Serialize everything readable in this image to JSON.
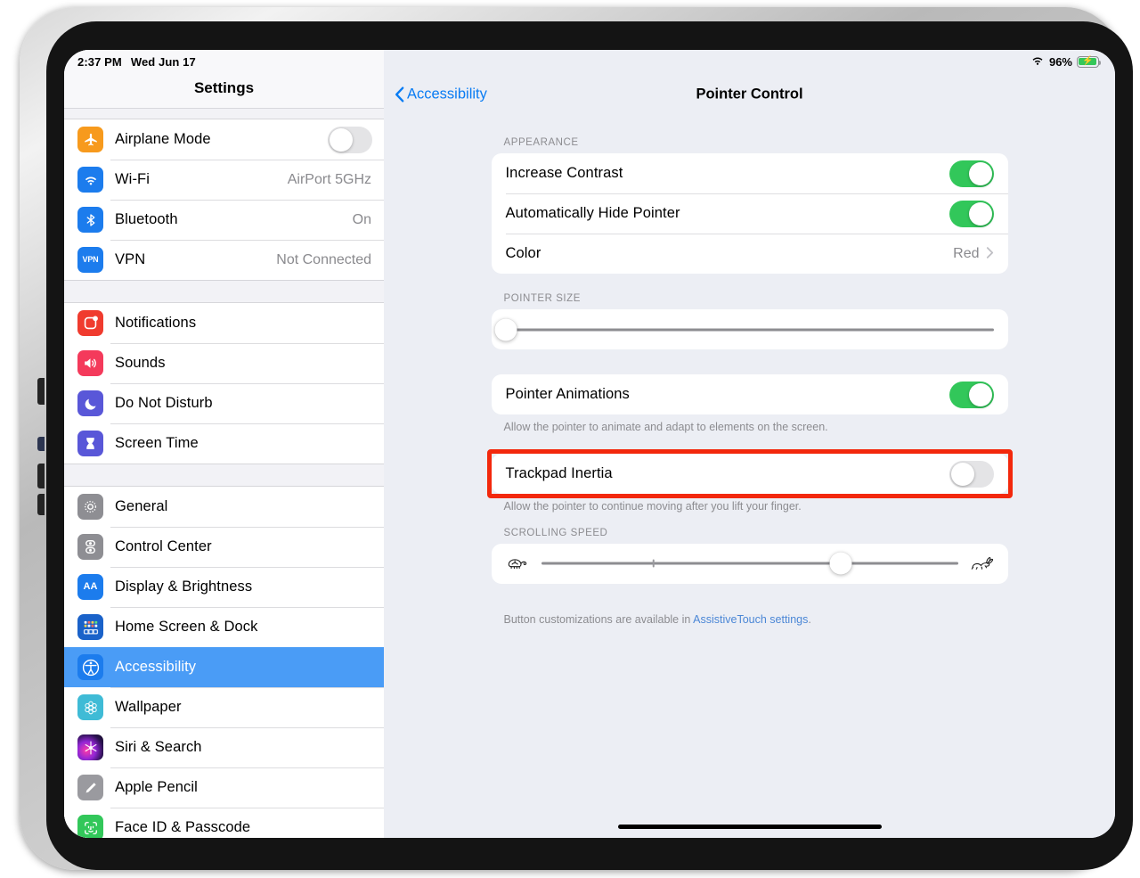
{
  "status_bar": {
    "time": "2:37 PM",
    "date": "Wed Jun 17",
    "battery_percent": "96%",
    "battery_level": 96,
    "wifi_icon": "wifi-icon",
    "battery_icon": "battery-charging-icon"
  },
  "sidebar": {
    "title": "Settings",
    "groups": [
      {
        "items": [
          {
            "label": "Airplane Mode",
            "icon": "airplane-icon",
            "control": "toggle",
            "toggle_on": false
          },
          {
            "label": "Wi-Fi",
            "icon": "wifi-icon",
            "value": "AirPort 5GHz"
          },
          {
            "label": "Bluetooth",
            "icon": "bluetooth-icon",
            "value": "On"
          },
          {
            "label": "VPN",
            "icon": "vpn-icon",
            "value": "Not Connected"
          }
        ]
      },
      {
        "items": [
          {
            "label": "Notifications",
            "icon": "notifications-icon"
          },
          {
            "label": "Sounds",
            "icon": "sounds-icon"
          },
          {
            "label": "Do Not Disturb",
            "icon": "do-not-disturb-icon"
          },
          {
            "label": "Screen Time",
            "icon": "screen-time-icon"
          }
        ]
      },
      {
        "items": [
          {
            "label": "General",
            "icon": "gear-icon"
          },
          {
            "label": "Control Center",
            "icon": "control-center-icon"
          },
          {
            "label": "Display & Brightness",
            "icon": "display-brightness-icon"
          },
          {
            "label": "Home Screen & Dock",
            "icon": "home-screen-dock-icon"
          },
          {
            "label": "Accessibility",
            "icon": "accessibility-icon",
            "selected": true
          },
          {
            "label": "Wallpaper",
            "icon": "wallpaper-icon"
          },
          {
            "label": "Siri & Search",
            "icon": "siri-icon"
          },
          {
            "label": "Apple Pencil",
            "icon": "apple-pencil-icon"
          },
          {
            "label": "Face ID & Passcode",
            "icon": "face-id-icon"
          }
        ]
      }
    ]
  },
  "detail": {
    "back_label": "Accessibility",
    "title": "Pointer Control",
    "appearance": {
      "header": "APPEARANCE",
      "rows": [
        {
          "label": "Increase Contrast",
          "control": "toggle",
          "toggle_on": true
        },
        {
          "label": "Automatically Hide Pointer",
          "control": "toggle",
          "toggle_on": true
        },
        {
          "label": "Color",
          "control": "disclosure",
          "value": "Red"
        }
      ]
    },
    "pointer_size": {
      "header": "POINTER SIZE",
      "slider_value": 0
    },
    "pointer_animations": {
      "label": "Pointer Animations",
      "toggle_on": true,
      "footer": "Allow the pointer to animate and adapt to elements on the screen."
    },
    "trackpad_inertia": {
      "label": "Trackpad Inertia",
      "toggle_on": false,
      "footer": "Allow the pointer to continue moving after you lift your finger.",
      "highlight_color": "#f3280c"
    },
    "scrolling_speed": {
      "header": "SCROLLING SPEED",
      "slider_value": 72,
      "tick_value": 27,
      "min_icon": "tortoise-icon",
      "max_icon": "hare-icon"
    },
    "footer_text_before": "Button customizations are available in ",
    "footer_link": "AssistiveTouch settings",
    "footer_text_after": "."
  }
}
